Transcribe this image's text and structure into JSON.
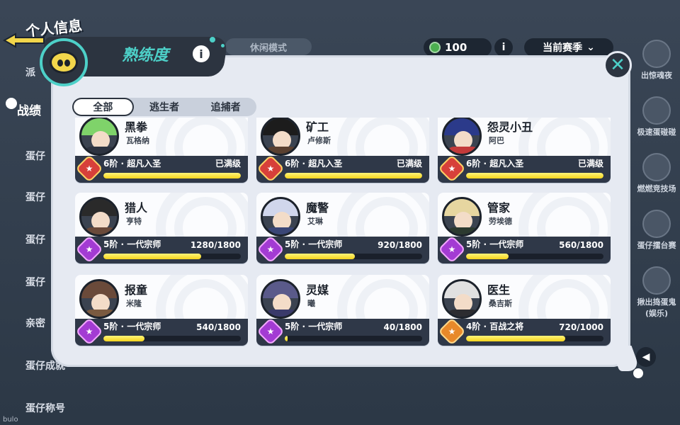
{
  "background": {
    "page_title": "个人信息",
    "left_menu": [
      {
        "label": "派",
        "active": false
      },
      {
        "label": "战绩",
        "active": true
      },
      {
        "label": "蛋仔",
        "active": false
      },
      {
        "label": "蛋仔",
        "active": false
      },
      {
        "label": "蛋仔",
        "active": false
      },
      {
        "label": "蛋仔",
        "active": false
      },
      {
        "label": "亲密",
        "active": false
      },
      {
        "label": "蛋仔成就",
        "active": false
      },
      {
        "label": "蛋仔称号",
        "active": false
      }
    ],
    "mode_tab": "休闲模式",
    "coin_value": "100",
    "info_glyph": "i",
    "season_label": "当前赛季",
    "right_items": [
      {
        "label": "出惊魂夜",
        "icon": "night-icon"
      },
      {
        "label": "极速蛋碰碰",
        "icon": "bumper-icon"
      },
      {
        "label": "燃燃竞技场",
        "icon": "arena-icon"
      },
      {
        "label": "蛋仔擂台赛",
        "icon": "ring-icon"
      },
      {
        "label": "揪出捣蛋鬼(娱乐)",
        "icon": "ghost-icon"
      }
    ],
    "bottom_text": "bulo"
  },
  "modal": {
    "title": "熟练度",
    "info_glyph": "i",
    "close_glyph": "✕",
    "tabs": [
      {
        "label": "全部",
        "active": true
      },
      {
        "label": "逃生者",
        "active": false
      },
      {
        "label": "追捕者",
        "active": false
      }
    ],
    "cards": [
      {
        "name": "黑拳",
        "sub": "瓦格纳",
        "rank": "6阶 · 超凡入圣",
        "progress_text": "已满级",
        "progress": 1.0,
        "tier_color": "red",
        "hair": "#7fd36a",
        "body": "#2d3340"
      },
      {
        "name": "矿工",
        "sub": "卢修斯",
        "rank": "6阶 · 超凡入圣",
        "progress_text": "已满级",
        "progress": 1.0,
        "tier_color": "red",
        "hair": "#1c1c1c",
        "body": "#5a4030"
      },
      {
        "name": "怨灵小丑",
        "sub": "阿巴",
        "rank": "6阶 · 超凡入圣",
        "progress_text": "已满级",
        "progress": 1.0,
        "tier_color": "red",
        "hair": "#2b3a8a",
        "body": "#c33a3a"
      },
      {
        "name": "猎人",
        "sub": "亨特",
        "rank": "5阶 · 一代宗师",
        "progress_text": "1280/1800",
        "progress": 0.711,
        "tier_color": "purple",
        "hair": "#2a2a2a",
        "body": "#6a4a3a"
      },
      {
        "name": "魔警",
        "sub": "艾琳",
        "rank": "5阶 · 一代宗师",
        "progress_text": "920/1800",
        "progress": 0.511,
        "tier_color": "purple",
        "hair": "#d0d6ec",
        "body": "#3a4676"
      },
      {
        "name": "管家",
        "sub": "劳埃德",
        "rank": "5阶 · 一代宗师",
        "progress_text": "560/1800",
        "progress": 0.311,
        "tier_color": "purple",
        "hair": "#e6d6a0",
        "body": "#2c3a30"
      },
      {
        "name": "报童",
        "sub": "米隆",
        "rank": "5阶 · 一代宗师",
        "progress_text": "540/1800",
        "progress": 0.3,
        "tier_color": "purple",
        "hair": "#6a4a3a",
        "body": "#7a5a40"
      },
      {
        "name": "灵媒",
        "sub": "曦",
        "rank": "5阶 · 一代宗师",
        "progress_text": "40/1800",
        "progress": 0.022,
        "tier_color": "purple",
        "hair": "#5a5a8a",
        "body": "#3a3a6a"
      },
      {
        "name": "医生",
        "sub": "桑吉斯",
        "rank": "4阶 · 百战之将",
        "progress_text": "720/1000",
        "progress": 0.72,
        "tier_color": "orange",
        "hair": "#e0e0e0",
        "body": "#2c2c30"
      }
    ]
  }
}
